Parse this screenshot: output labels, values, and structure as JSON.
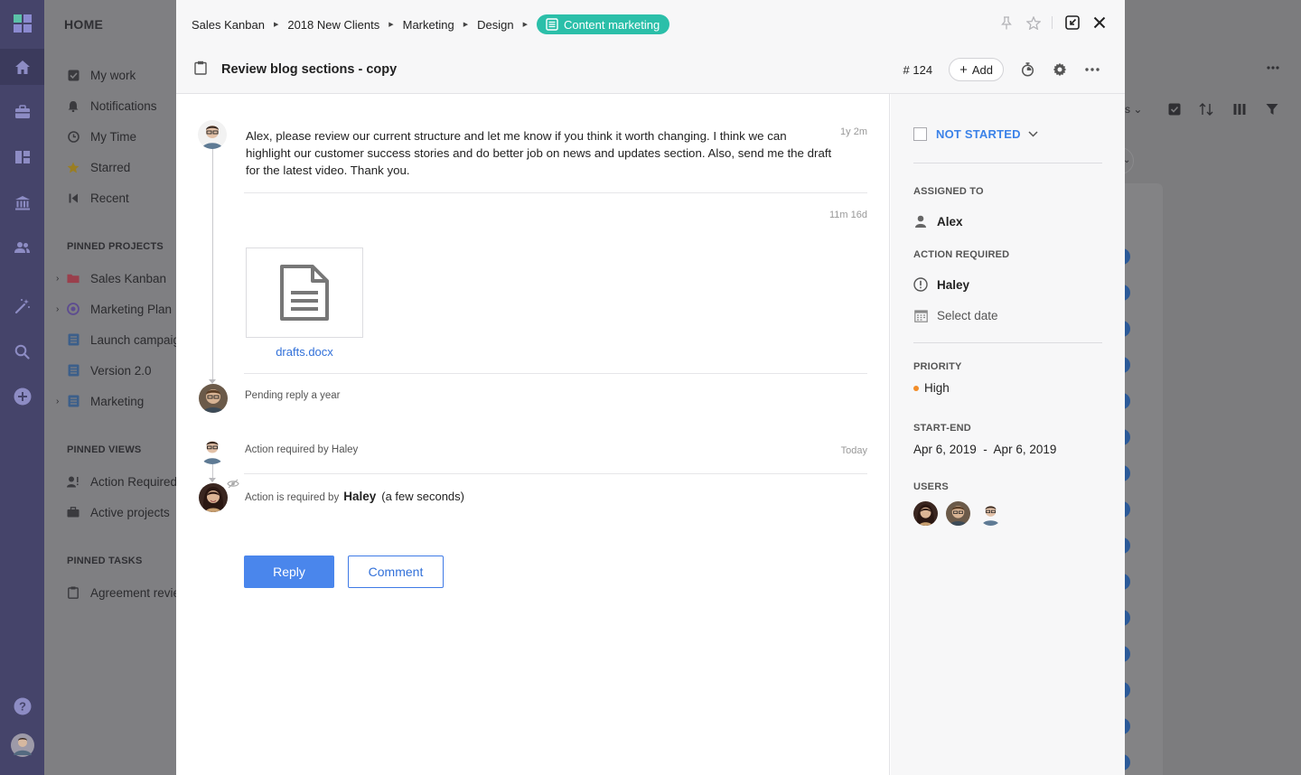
{
  "sidebar": {
    "home": "HOME",
    "items": [
      {
        "label": "My work",
        "icon": "checkbox-icon"
      },
      {
        "label": "Notifications",
        "icon": "bell-icon"
      },
      {
        "label": "My Time",
        "icon": "clock-icon"
      },
      {
        "label": "Starred",
        "icon": "star-icon"
      },
      {
        "label": "Recent",
        "icon": "recent-icon"
      }
    ],
    "pinned_projects_title": "PINNED PROJECTS",
    "pinned_projects": [
      {
        "label": "Sales Kanban",
        "icon": "folder-icon"
      },
      {
        "label": "Marketing Plan",
        "icon": "target-icon"
      },
      {
        "label": "Launch campaign",
        "icon": "list-icon"
      },
      {
        "label": "Version 2.0",
        "icon": "list-icon"
      },
      {
        "label": "Marketing",
        "icon": "list-icon"
      }
    ],
    "pinned_views_title": "PINNED VIEWS",
    "pinned_views": [
      {
        "label": "Action Required",
        "icon": "user-action-icon"
      },
      {
        "label": "Active projects",
        "icon": "briefcase-icon"
      }
    ],
    "pinned_tasks_title": "PINNED TASKS",
    "pinned_tasks": [
      {
        "label": "Agreement review",
        "icon": "clipboard-icon"
      }
    ]
  },
  "breadcrumb": {
    "items": [
      "Sales Kanban",
      "2018 New Clients",
      "Marketing",
      "Design"
    ],
    "current": "Content marketing",
    "current_color": "#2bbfa9"
  },
  "task": {
    "title": "Review blog sections - copy",
    "number": "# 124",
    "add_label": "Add"
  },
  "stream": {
    "message": "Alex, please review our current structure and let me know if you think it worth changing. I think we can highlight our customer success stories and do better job on news and updates section. Also, send me the draft for the latest video. Thank you.",
    "message_time": "1y 2m",
    "attachment_time": "11m 16d",
    "attachment_name": "drafts.docx",
    "pending_text": "Pending reply a year",
    "action_text": "Action required by Haley",
    "action_time": "Today",
    "action_required_prefix": "Action is required by",
    "action_required_user": "Haley",
    "action_required_ago": "(a few seconds)",
    "reply_label": "Reply",
    "comment_label": "Comment",
    "primary_color": "#4a86ec"
  },
  "panel": {
    "status": "NOT STARTED",
    "status_color": "#3b82e8",
    "assigned_label": "ASSIGNED TO",
    "assignee": "Alex",
    "action_label": "ACTION REQUIRED",
    "action_user": "Haley",
    "select_date": "Select date",
    "priority_label": "PRIORITY",
    "priority": "High",
    "priority_color": "#f28c28",
    "start_end_label": "START-END",
    "start_end": "Apr 6, 2019  -  Apr 6, 2019",
    "users_label": "USERS"
  }
}
